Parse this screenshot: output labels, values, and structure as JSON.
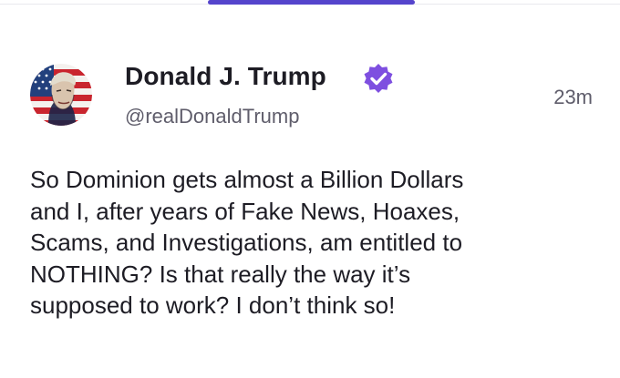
{
  "post": {
    "author": {
      "display_name": "Donald J. Trump",
      "handle": "@realDonaldTrump",
      "verified": true,
      "avatar_icon": "flag-portrait-avatar",
      "verified_icon": "verified-badge-icon"
    },
    "timestamp": "23m",
    "body_lines": [
      "So Dominion gets almost a Billion Dollars",
      "and I, after years of Fake News, Hoaxes,",
      "Scams, and Investigations, am entitled to",
      "NOTHING? Is that really the way it’s",
      "supposed to work? I don’t think so!"
    ]
  },
  "colors": {
    "accent": "#5544cc",
    "verified_badge": "#7e4fe0",
    "text_primary": "#1d1c24",
    "text_secondary": "#5f5d6b"
  }
}
